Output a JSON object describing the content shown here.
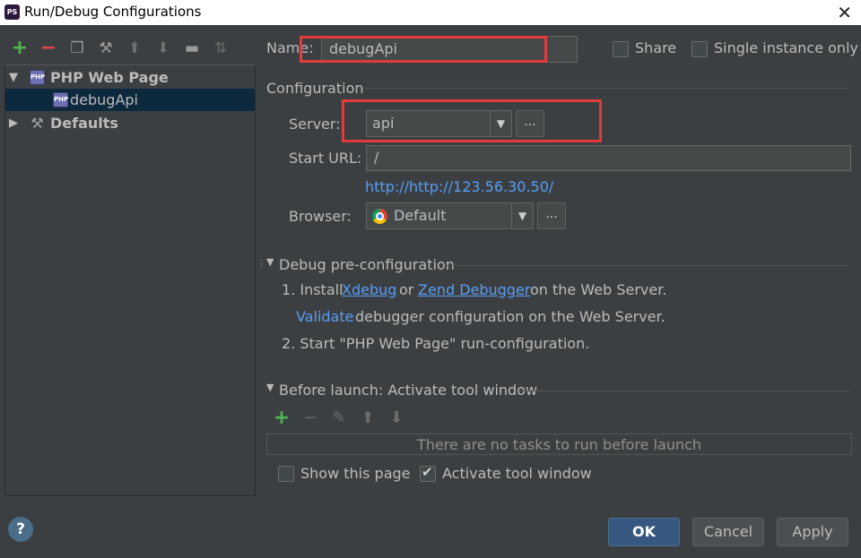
{
  "window": {
    "title": "Run/Debug Configurations",
    "app_icon": "PS"
  },
  "left_toolbar": [
    "add-icon",
    "remove-icon",
    "copy-icon",
    "wrench-icon",
    "arrow-up-icon",
    "arrow-down-icon",
    "folder-icon",
    "sort-icon"
  ],
  "tree": {
    "group": "PHP Web Page",
    "child": "debugApi",
    "defaults": "Defaults"
  },
  "name_label": "Name:",
  "name_value": "debugApi",
  "share_label": "Share",
  "single_instance_label": "Single instance only",
  "configuration_header": "Configuration",
  "server_label": "Server:",
  "server_value": "api",
  "start_url_label": "Start URL:",
  "start_url_value": "/",
  "resolved_url": "http://http://123.56.30.50/",
  "browser_label": "Browser:",
  "browser_value": "Default",
  "ellipsis": "...",
  "debug_pre": {
    "header": "Debug pre-configuration",
    "step1_prefix": "1. Install",
    "xdebug": "Xdebug",
    "or": "or",
    "zend": "Zend Debugger",
    "step1_suffix": "on the Web Server.",
    "validate": "Validate",
    "validate_suffix": "debugger configuration on the Web Server.",
    "step2": "2. Start \"PHP Web Page\" run-configuration."
  },
  "before_launch": {
    "header": "Before launch: Activate tool window",
    "empty": "There are no tasks to run before launch"
  },
  "show_this_page": "Show this page",
  "activate_tool_window": "Activate tool window",
  "buttons": {
    "ok": "OK",
    "cancel": "Cancel",
    "apply": "Apply",
    "help": "?"
  },
  "colors": {
    "background": "#3c3f41",
    "link": "#589df6",
    "selection": "#0d293e",
    "highlight": "#e13b3b"
  }
}
